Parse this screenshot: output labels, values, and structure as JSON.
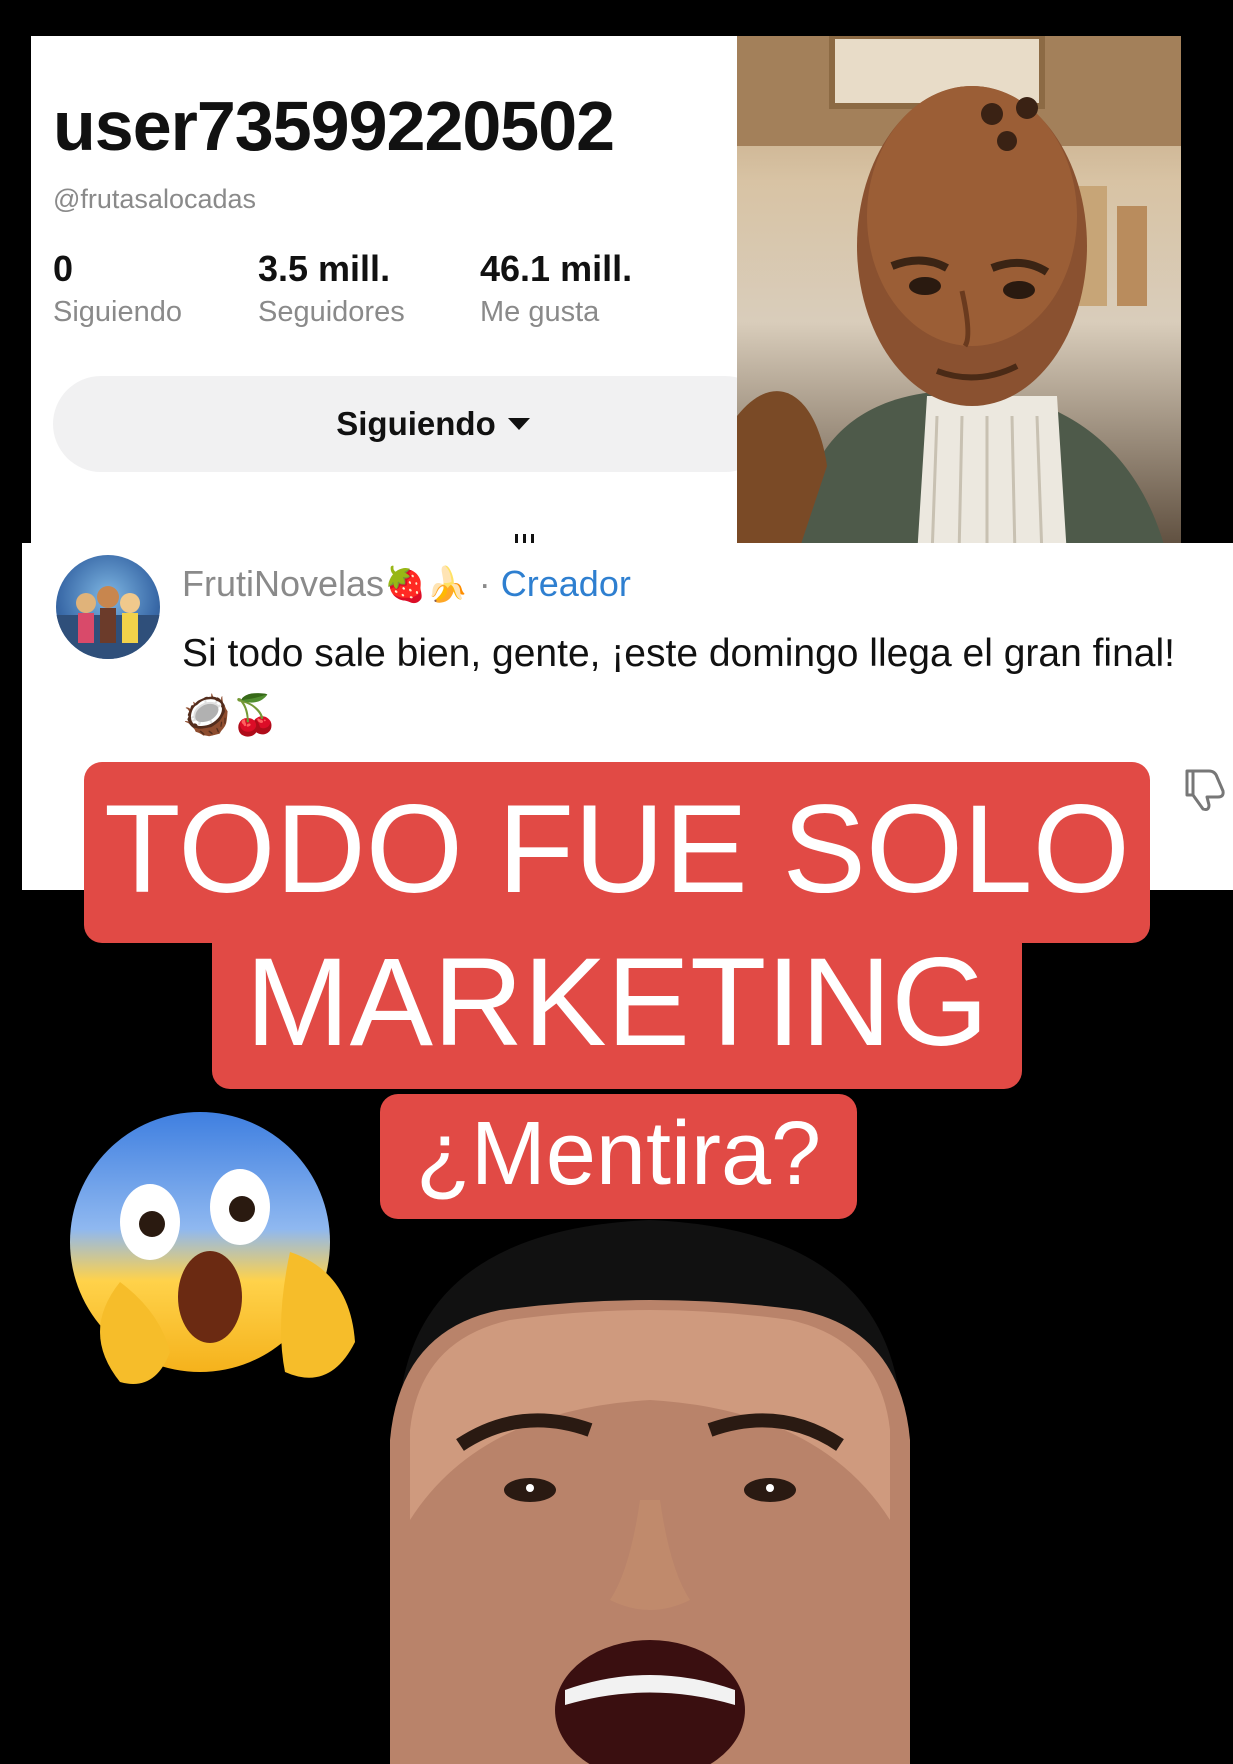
{
  "profile": {
    "username": "user73599220502",
    "handle": "@frutasalocadas",
    "stats": [
      {
        "value": "0",
        "label": "Siguiendo"
      },
      {
        "value": "3.5 mill.",
        "label": "Seguidores"
      },
      {
        "value": "46.1 mill.",
        "label": "Me gusta"
      }
    ],
    "follow_button": "Siguiendo"
  },
  "comment": {
    "author": "FrutiNovelas",
    "author_emojis": "🍓🍌",
    "separator": "·",
    "badge": "Creador",
    "text": "Si todo sale bien, gente, ¡este domingo llega el gran final! 🥥🍒",
    "badge_color": "#2e7fd0"
  },
  "overlay": {
    "line1": "TODO FUE SOLO",
    "line2": "MARKETING",
    "line3": "¿Mentira?",
    "banner_color": "#e14a45"
  },
  "icons": [
    "caret-down-icon",
    "dislike-icon",
    "screaming-face-emoji"
  ]
}
